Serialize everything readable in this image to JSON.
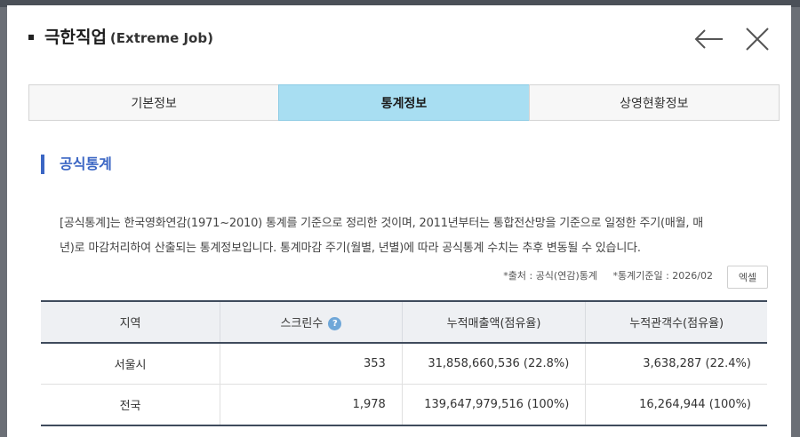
{
  "modal": {
    "title_ko": "극한직업",
    "title_en": "(Extreme Job)",
    "icons": {
      "back": "arrow-left-icon",
      "close": "close-icon"
    }
  },
  "tabs": [
    {
      "label": "기본정보",
      "active": false
    },
    {
      "label": "통계정보",
      "active": true
    },
    {
      "label": "상영현황정보",
      "active": false
    }
  ],
  "section": {
    "title": "공식통계",
    "description_line1": "[공식통계]는 한국영화연감(1971~2010) 통계를 기준으로 정리한 것이며, 2011년부터는 통합전산망을 기준으로 일정한 주기(매월, 매",
    "description_line2": "년)로 마감처리하여 산출되는 통계정보입니다. 통계마감 주기(월별, 년별)에 따라 공식통계 수치는 추후 변동될 수 있습니다.",
    "source": "*출처 : 공식(연감)통계",
    "base_date": "*통계기준일 : 2026/02",
    "excel_button": "엑셀"
  },
  "table": {
    "headers": [
      "지역",
      "스크린수",
      "누적매출액(점유율)",
      "누적관객수(점유율)"
    ],
    "help_glyph": "?",
    "rows": [
      {
        "region": "서울시",
        "screens": "353",
        "sales": "31,858,660,536 (22.8%)",
        "audience": "3,638,287 (22.4%)"
      },
      {
        "region": "전국",
        "screens": "1,978",
        "sales": "139,647,979,516 (100%)",
        "audience": "16,264,944 (100%)"
      }
    ]
  },
  "colors": {
    "accent_blue": "#3b66c4",
    "active_tab": "#a8def2",
    "help_icon": "#6fa7d8",
    "table_rule": "#3f4b5c"
  }
}
